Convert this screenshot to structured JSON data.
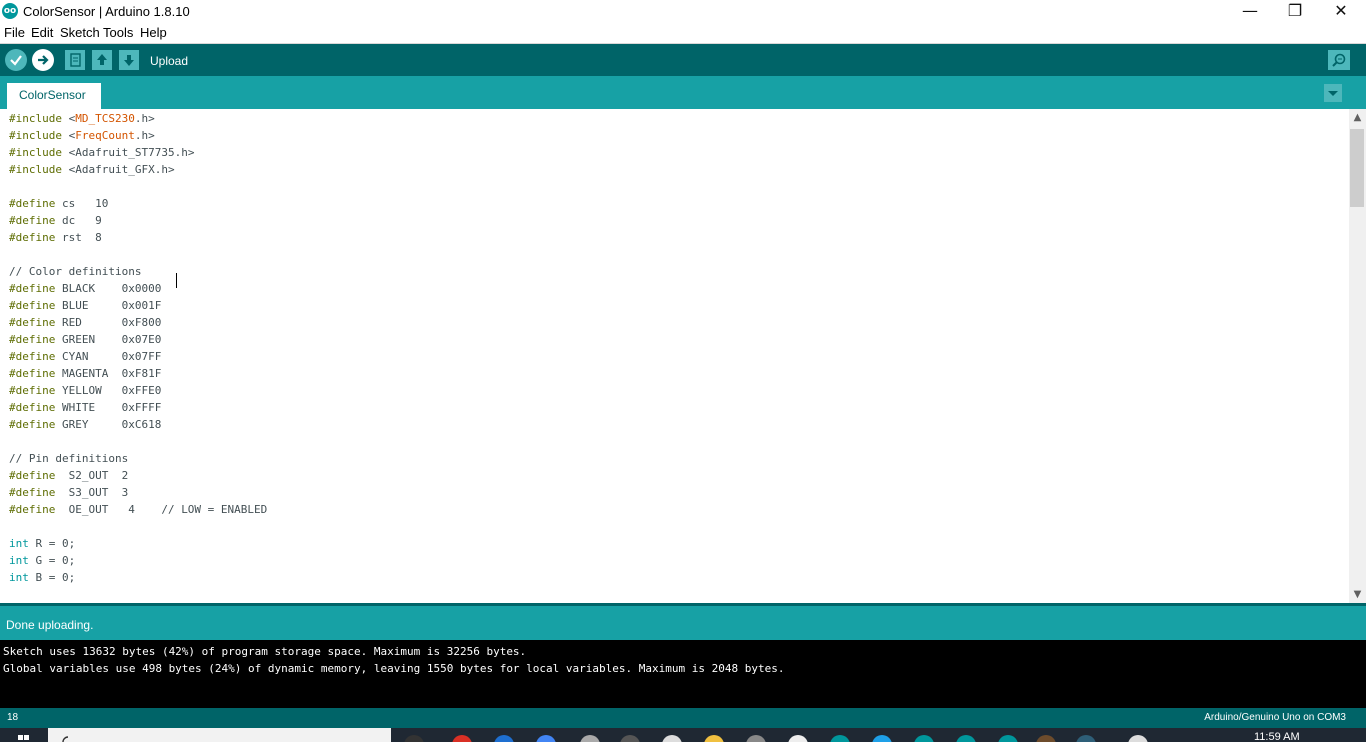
{
  "window": {
    "icon": "arduino-icon",
    "icon_glyph": "oo",
    "title": "ColorSensor | Arduino 1.8.10",
    "minimize_glyph": "—",
    "restore_glyph": "❐",
    "close_glyph": "✕"
  },
  "menu": [
    "File",
    "Edit",
    "Sketch",
    "Tools",
    "Help"
  ],
  "toolbar": {
    "buttons": [
      "verify-icon",
      "upload-icon",
      "new-icon",
      "open-icon",
      "save-icon",
      "serial-monitor-icon"
    ],
    "hover_label": "Upload"
  },
  "tabs": {
    "active": "ColorSensor",
    "menu_icon": "chevron-down-icon",
    "menu_glyph": "▼"
  },
  "editor": {
    "lines": [
      {
        "kw": "#include",
        "rest": " <",
        "lib": "MD_TCS230",
        "tail": ".h>"
      },
      {
        "kw": "#include",
        "rest": " <",
        "lib": "FreqCount",
        "tail": ".h>"
      },
      {
        "kw": "#include",
        "rest": " <Adafruit_ST7735.h>"
      },
      {
        "kw": "#include",
        "rest": " <Adafruit_GFX.h>"
      },
      {},
      {
        "kw": "#define",
        "rest": " cs   10"
      },
      {
        "kw": "#define",
        "rest": " dc   9"
      },
      {
        "kw": "#define",
        "rest": " rst  8"
      },
      {},
      {
        "cm": "// Color definitions"
      },
      {
        "kw": "#define",
        "rest": " BLACK    0x0000"
      },
      {
        "kw": "#define",
        "rest": " BLUE     0x001F"
      },
      {
        "kw": "#define",
        "rest": " RED      0xF800"
      },
      {
        "kw": "#define",
        "rest": " GREEN    0x07E0"
      },
      {
        "kw": "#define",
        "rest": " CYAN     0x07FF"
      },
      {
        "kw": "#define",
        "rest": " MAGENTA  0xF81F"
      },
      {
        "kw": "#define",
        "rest": " YELLOW   0xFFE0"
      },
      {
        "kw": "#define",
        "rest": " WHITE    0xFFFF"
      },
      {
        "kw": "#define",
        "rest": " GREY     0xC618"
      },
      {},
      {
        "cm": "// Pin definitions"
      },
      {
        "kw": "#define",
        "rest": "  S2_OUT  2"
      },
      {
        "kw": "#define",
        "rest": "  S3_OUT  3"
      },
      {
        "kw": "#define",
        "rest": "  OE_OUT   4    // LOW = ENABLED"
      },
      {},
      {
        "ty": "int",
        "rest": " R = 0;"
      },
      {
        "ty": "int",
        "rest": " G = 0;"
      },
      {
        "ty": "int",
        "rest": " B = 0;"
      }
    ]
  },
  "scrollbar": {
    "up_glyph": "▲",
    "down_glyph": "▼"
  },
  "status": {
    "message": "Done uploading."
  },
  "console": {
    "lines": [
      "Sketch uses 13632 bytes (42%) of program storage space. Maximum is 32256 bytes.",
      "Global variables use 498 bytes (24%) of dynamic memory, leaving 1550 bytes for local variables. Maximum is 2048 bytes."
    ]
  },
  "footer": {
    "line_number": "18",
    "board": "Arduino/Genuino Uno on COM3"
  },
  "taskbar": {
    "time": "11:59 AM"
  },
  "colors": {
    "toolbar": "#006468",
    "tabbar": "#17a1a5",
    "button": "#4db7bb",
    "keyword": "#5e6d03",
    "library": "#d35400",
    "type": "#00979c"
  }
}
